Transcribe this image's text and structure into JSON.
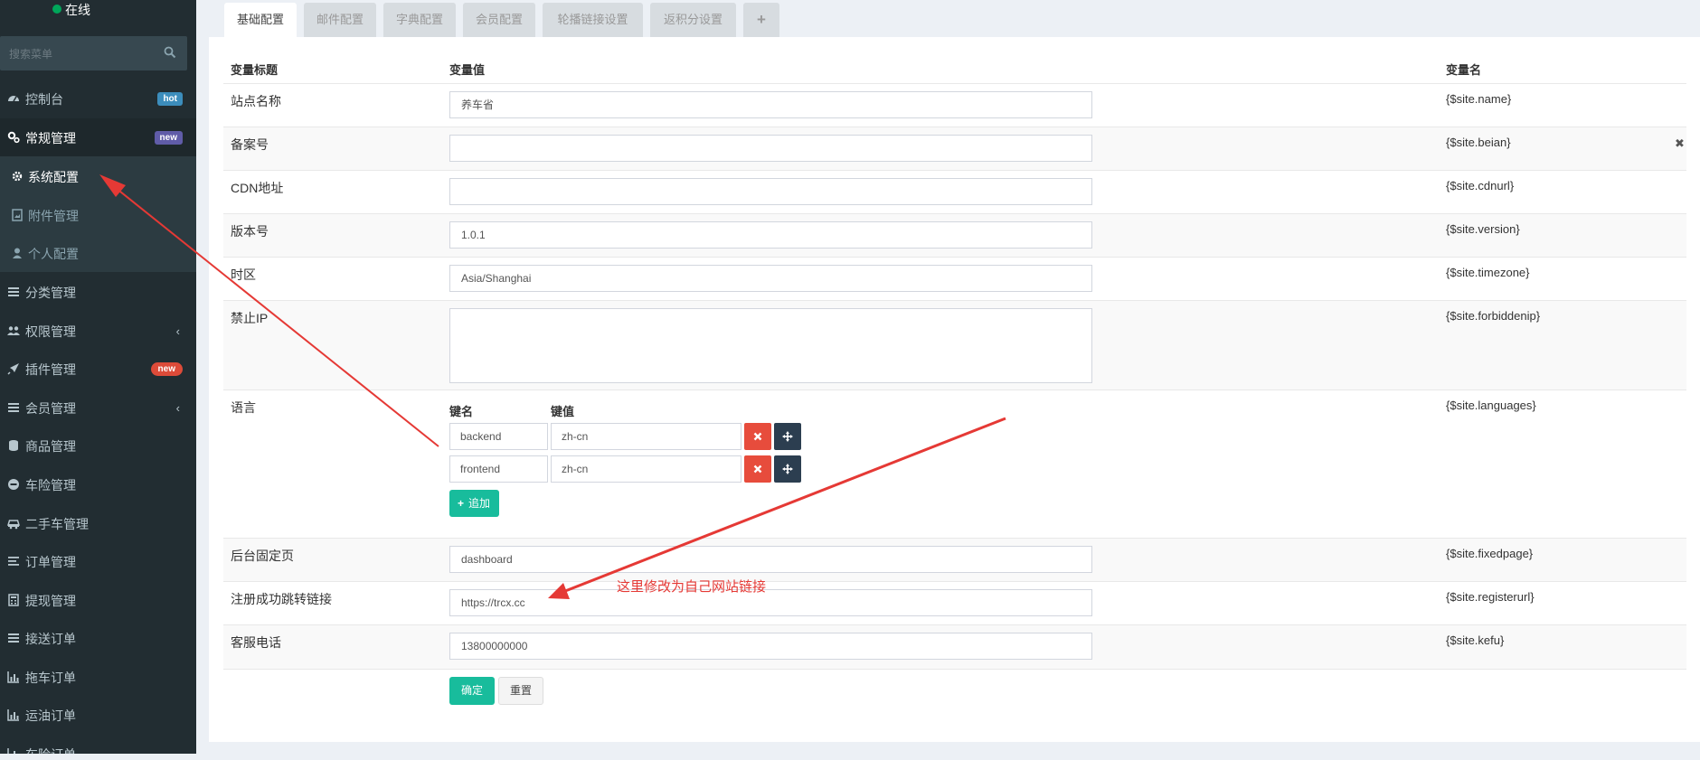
{
  "sidebar": {
    "status_text": "在线",
    "search_placeholder": "搜索菜单",
    "items": [
      {
        "label": "控制台",
        "badge": "hot",
        "badge_color": "#3c8dbc",
        "icon": "dashboard-icon"
      },
      {
        "label": "常规管理",
        "badge": "new",
        "badge_color": "#605ca8",
        "icon": "cogs-icon"
      },
      {
        "label": "系统配置",
        "icon": "gear-icon"
      },
      {
        "label": "附件管理",
        "icon": "file-image-icon"
      },
      {
        "label": "个人配置",
        "icon": "user-icon"
      },
      {
        "label": "分类管理",
        "icon": "list-icon"
      },
      {
        "label": "权限管理",
        "icon": "group-icon"
      },
      {
        "label": "插件管理",
        "badge": "new",
        "badge_color": "#dd4b39",
        "icon": "rocket-icon"
      },
      {
        "label": "会员管理",
        "icon": "list-icon"
      },
      {
        "label": "商品管理",
        "icon": "database-icon"
      },
      {
        "label": "车险管理",
        "icon": "minus-circle-icon"
      },
      {
        "label": "二手车管理",
        "icon": "car-icon"
      },
      {
        "label": "订单管理",
        "icon": "align-left-icon"
      },
      {
        "label": "提现管理",
        "icon": "calculator-icon"
      },
      {
        "label": "接送订单",
        "icon": "bars-icon"
      },
      {
        "label": "拖车订单",
        "icon": "bar-chart-icon"
      },
      {
        "label": "运油订单",
        "icon": "bar-chart-icon"
      },
      {
        "label": "车险订单",
        "icon": "bar-chart-icon"
      }
    ]
  },
  "tabs": [
    {
      "label": "基础配置",
      "active": true
    },
    {
      "label": "邮件配置"
    },
    {
      "label": "字典配置"
    },
    {
      "label": "会员配置"
    },
    {
      "label": "轮播链接设置"
    },
    {
      "label": "返积分设置"
    },
    {
      "label": "+"
    }
  ],
  "table": {
    "headers": {
      "title": "变量标题",
      "value": "变量值",
      "name": "变量名"
    },
    "rows": [
      {
        "title": "站点名称",
        "value": "养车省",
        "var": "{$site.name}"
      },
      {
        "title": "备案号",
        "value": "",
        "var": "{$site.beian}"
      },
      {
        "title": "CDN地址",
        "value": "",
        "var": "{$site.cdnurl}"
      },
      {
        "title": "版本号",
        "value": "1.0.1",
        "var": "{$site.version}"
      },
      {
        "title": "时区",
        "value": "Asia/Shanghai",
        "var": "{$site.timezone}"
      },
      {
        "title": "禁止IP",
        "value": "",
        "var": "{$site.forbiddenip}"
      },
      {
        "title": "语言",
        "var": "{$site.languages}"
      },
      {
        "title": "后台固定页",
        "value": "dashboard",
        "var": "{$site.fixedpage}"
      },
      {
        "title": "注册成功跳转链接",
        "value": "https://trcx.cc",
        "var": "{$site.registerurl}"
      },
      {
        "title": "客服电话",
        "value": "13800000000",
        "var": "{$site.kefu}"
      }
    ],
    "languages": {
      "key_header": "键名",
      "value_header": "键值",
      "pairs": [
        {
          "key": "backend",
          "value": "zh-cn"
        },
        {
          "key": "frontend",
          "value": "zh-cn"
        }
      ],
      "add_label": "追加"
    }
  },
  "buttons": {
    "confirm": "确定",
    "reset": "重置"
  },
  "annotation": {
    "text": "这里修改为自己网站链接",
    "color": "#e53935"
  },
  "colors": {
    "accent": "#18bc9c",
    "danger": "#e74c3c",
    "dark": "#2c3e50",
    "sidebar": "#222d32"
  }
}
